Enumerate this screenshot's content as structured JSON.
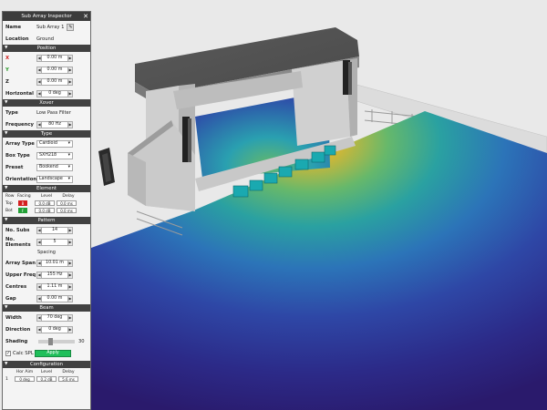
{
  "inspector": {
    "title": "Sub Array Inspector",
    "close_icon": "close-icon",
    "name_label": "Name",
    "name_value": "Sub Array 1",
    "location_label": "Location",
    "location_value": "Ground",
    "position": {
      "title": "Position",
      "x_label": "X",
      "x_value": "0.00 m",
      "y_label": "Y",
      "y_value": "0.00 m",
      "z_label": "Z",
      "z_value": "0.00 m",
      "horizontal_label": "Horizontal",
      "horizontal_value": "0 deg"
    },
    "xover": {
      "title": "Xover",
      "type_label": "Type",
      "type_value": "Low Pass Filter",
      "frequency_label": "Frequency",
      "frequency_value": "80 Hz"
    },
    "type_section": {
      "title": "Type",
      "array_type_label": "Array Type",
      "array_type_value": "Cardioid",
      "box_type_label": "Box Type",
      "box_type_value": "SXH218",
      "preset_label": "Preset",
      "preset_value": "Bookend",
      "orientation_label": "Orientation",
      "orientation_value": "Landscape"
    },
    "element": {
      "title": "Element",
      "headers": [
        "Row",
        "Facing",
        "Level",
        "Delay"
      ],
      "rows": [
        {
          "row": "Top",
          "facing": "B",
          "facing_color": "#d42020",
          "level": "0.0 dB",
          "delay": "0.0 ms"
        },
        {
          "row": "Bot",
          "facing": "F",
          "facing_color": "#22a036",
          "level": "0.0 dB",
          "delay": "0.0 ms"
        }
      ]
    },
    "pattern": {
      "title": "Pattern",
      "subs_label": "No. Subs",
      "subs_value": "14",
      "elements_label": "No. Elements",
      "elements_value": "5",
      "spacing_title": "Spacing",
      "span_label": "Array Span",
      "span_value": "10.01 m",
      "upper_freq_label": "Upper Freq",
      "upper_freq_value": "155 Hz",
      "centres_label": "Centres",
      "centres_value": "1.11 m",
      "gap_label": "Gap",
      "gap_value": "0.00 m"
    },
    "beam": {
      "title": "Beam",
      "width_label": "Width",
      "width_value": "70 deg",
      "direction_label": "Direction",
      "direction_value": "0 deg",
      "shading_label": "Shading",
      "shading_value": "30",
      "shading_level": 0.3,
      "calc_label": "Calc SPL",
      "apply_label": "Apply"
    },
    "configuration": {
      "title": "Configuration",
      "headers": [
        "Hor Aim",
        "Level",
        "Delay"
      ],
      "rows": [
        {
          "index": "1",
          "hor_aim": "0 deg",
          "level": "0.2 dB",
          "delay": "5.6 ms"
        }
      ]
    }
  },
  "colors": {
    "panel_header": "#414141",
    "apply_button": "#1fbf5a",
    "heat_low": "#2a1a7a",
    "heat_mid": "#2aa0a0",
    "heat_high": "#e8c020"
  }
}
